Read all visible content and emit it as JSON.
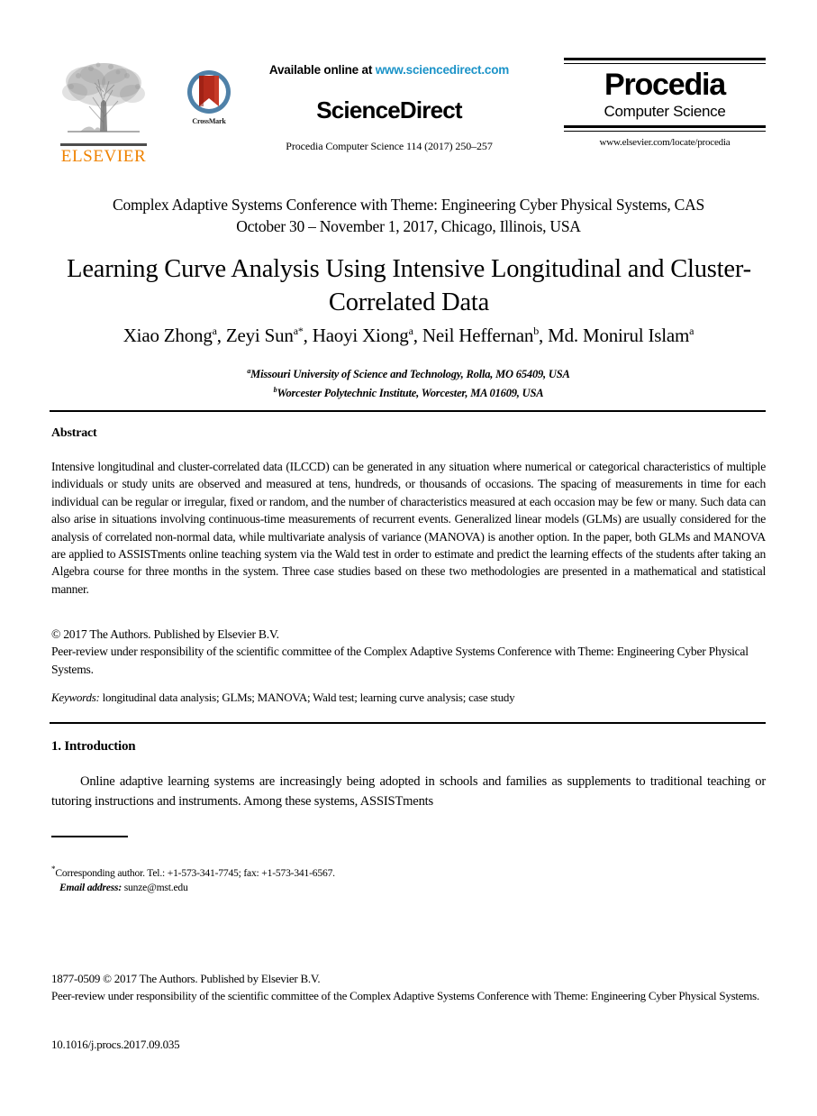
{
  "masthead": {
    "elsevier_logo_text": "ELSEVIER",
    "crossmark_label": "CrossMark",
    "available_prefix": "Available online at ",
    "available_url": "www.sciencedirect.com",
    "sciencedirect_wordmark": "ScienceDirect",
    "citation_line": "Procedia Computer Science 114 (2017) 250–257",
    "procedia_title": "Procedia",
    "procedia_subtitle": "Computer Science",
    "procedia_url": "www.elsevier.com/locate/procedia"
  },
  "conference": {
    "line1": "Complex Adaptive Systems Conference with Theme: Engineering Cyber Physical Systems, CAS",
    "line2": "October 30 – November 1, 2017, Chicago, Illinois, USA"
  },
  "paper": {
    "title": "Learning Curve Analysis Using Intensive Longitudinal and Cluster-Correlated Data",
    "authors_html": "Xiao Zhong<sup>a</sup>, Zeyi Sun<sup>a*</sup>, Haoyi Xiong<sup>a</sup>, Neil Heffernan<sup>b</sup>, Md. Monirul Islam<sup>a</sup>",
    "affiliation_a": "Missouri University of Science and Technology, Rolla, MO 65409, USA",
    "affiliation_b": "Worcester Polytechnic Institute, Worcester, MA 01609, USA"
  },
  "abstract": {
    "heading": "Abstract",
    "body": "Intensive longitudinal and cluster-correlated data (ILCCD) can be generated in any situation where numerical or categorical characteristics of multiple individuals or study units are observed and measured at tens, hundreds, or thousands of occasions. The spacing of measurements in time for each individual can be regular or irregular, fixed or random, and the number of characteristics measured at each occasion may be few or many. Such data can also arise in situations involving continuous-time measurements of recurrent events. Generalized linear models (GLMs) are usually considered for the analysis of correlated non-normal data, while multivariate analysis of variance (MANOVA) is another option. In the paper, both GLMs and MANOVA are applied to ASSISTments online teaching system via the Wald test in order to estimate and predict the learning effects of the students after taking an Algebra course for three months in the system. Three case studies based on these two methodologies are presented in a mathematical and statistical manner.",
    "copyright_line": "© 2017 The Authors. Published by Elsevier B.V.",
    "peer_review_line": "Peer-review under responsibility of the scientific committee of the Complex Adaptive Systems Conference with Theme: Engineering Cyber Physical Systems.",
    "keywords_label": "Keywords:",
    "keywords_value": " longitudinal data analysis; GLMs; MANOVA; Wald test; learning curve analysis; case study"
  },
  "introduction": {
    "heading": "1. Introduction",
    "body": "Online adaptive learning systems are increasingly being adopted in schools and families as supplements to traditional teaching or tutoring instructions and instruments. Among these systems, ASSISTments"
  },
  "footnote": {
    "marker": "*",
    "line1": "Corresponding author. Tel.: +1-573-341-7745; fax: +1-573-341-6567.",
    "email_label": "Email address:",
    "email_value": " sunze@mst.edu"
  },
  "footer": {
    "issn_line": "1877-0509 © 2017 The Authors. Published by Elsevier B.V.",
    "peer_review_line": "Peer-review under responsibility of the scientific committee of the Complex Adaptive Systems Conference with Theme: Engineering Cyber Physical Systems.",
    "doi": "10.1016/j.procs.2017.09.035"
  },
  "colors": {
    "elsevier_orange": "#ef8200",
    "link_blue": "#1b93c8",
    "crossmark_ring": "#4f81a8",
    "crossmark_ribbon": "#b52b1c"
  }
}
